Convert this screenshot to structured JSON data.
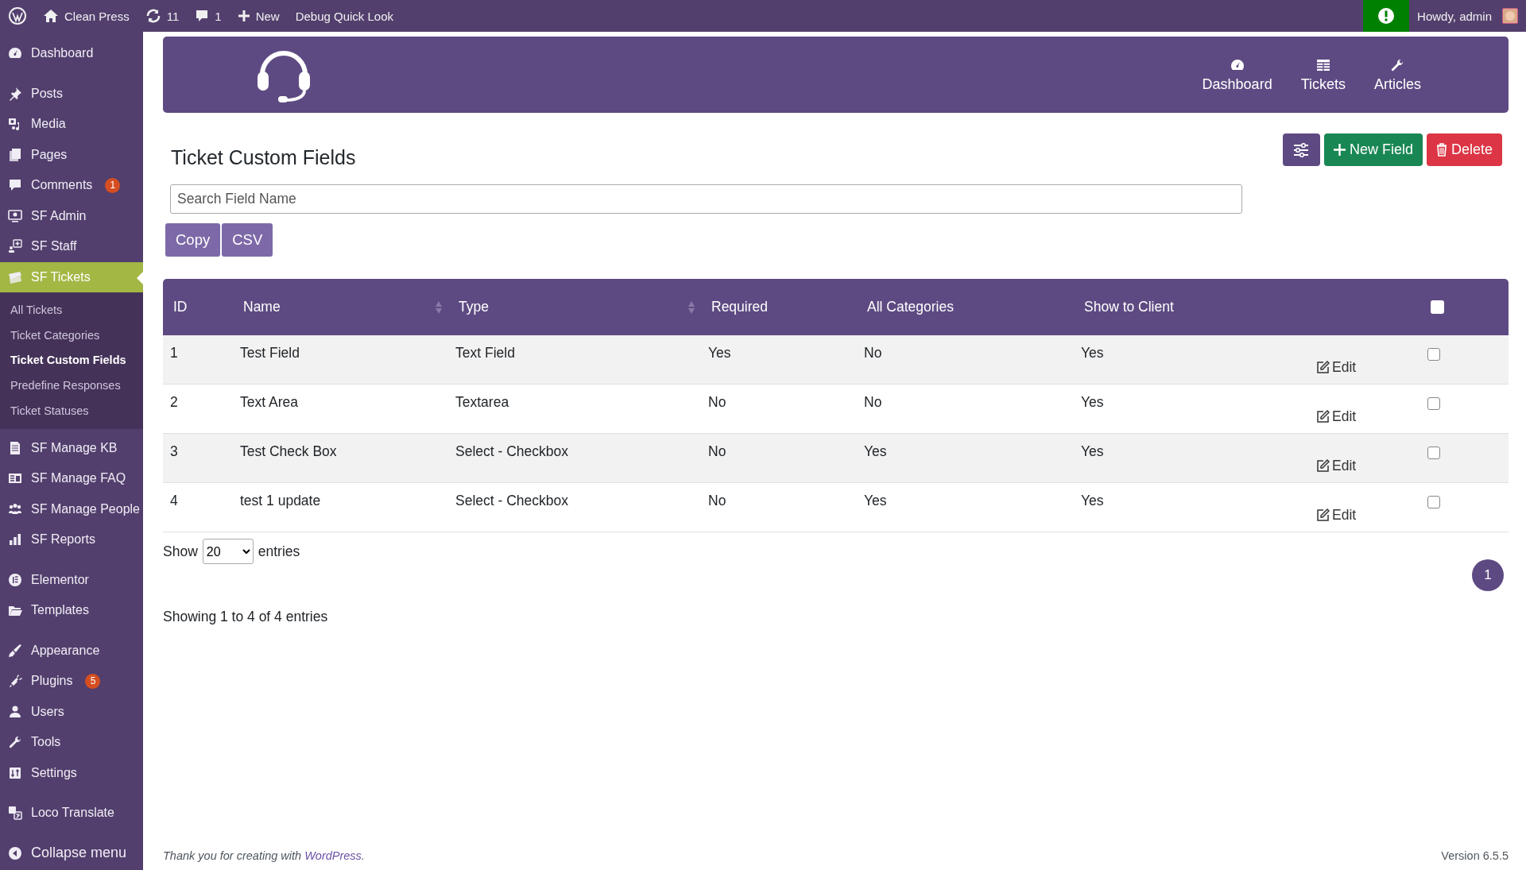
{
  "admin_bar": {
    "site_name": "Clean Press",
    "updates": "11",
    "comments": "1",
    "new_label": "New",
    "debug_label": "Debug Quick Look",
    "greeting": "Howdy, admin"
  },
  "sidebar": {
    "groups": [
      [
        {
          "label": "Dashboard",
          "kind": "dashboard",
          "selected": false
        }
      ],
      [
        {
          "label": "Posts",
          "kind": "pin",
          "selected": false
        },
        {
          "label": "Media",
          "kind": "media",
          "selected": false
        },
        {
          "label": "Pages",
          "kind": "pages",
          "selected": false
        },
        {
          "label": "Comments",
          "kind": "comment",
          "badge": "1",
          "selected": false
        },
        {
          "label": "SF Admin",
          "kind": "monitor",
          "selected": false
        },
        {
          "label": "SF Staff",
          "kind": "staff",
          "selected": false
        },
        {
          "label": "SF Tickets",
          "kind": "tickets",
          "selected": true,
          "children": [
            {
              "label": "All Tickets",
              "selected": false
            },
            {
              "label": "Ticket Categories",
              "selected": false
            },
            {
              "label": "Ticket Custom Fields",
              "selected": true
            },
            {
              "label": "Predefine Responses",
              "selected": false
            },
            {
              "label": "Ticket Statuses",
              "selected": false
            }
          ]
        },
        {
          "label": "SF Manage KB",
          "kind": "document",
          "selected": false
        },
        {
          "label": "SF Manage FAQ",
          "kind": "faq",
          "selected": false
        },
        {
          "label": "SF Manage People",
          "kind": "people",
          "selected": false
        },
        {
          "label": "SF Reports",
          "kind": "chart",
          "selected": false
        }
      ],
      [
        {
          "label": "Elementor",
          "kind": "elementor",
          "selected": false
        },
        {
          "label": "Templates",
          "kind": "folder",
          "selected": false
        }
      ],
      [
        {
          "label": "Appearance",
          "kind": "brush",
          "selected": false
        },
        {
          "label": "Plugins",
          "kind": "plug",
          "badge": "5",
          "selected": false
        },
        {
          "label": "Users",
          "kind": "user",
          "selected": false
        },
        {
          "label": "Tools",
          "kind": "wrench",
          "selected": false
        },
        {
          "label": "Settings",
          "kind": "settings",
          "selected": false
        }
      ],
      [
        {
          "label": "Loco Translate",
          "kind": "translate",
          "selected": false
        }
      ],
      [
        {
          "label": "Collapse menu",
          "kind": "collapse",
          "selected": false
        }
      ]
    ]
  },
  "header_nav": [
    {
      "label": "Dashboard",
      "kind": "dashboard"
    },
    {
      "label": "Tickets",
      "kind": "table"
    },
    {
      "label": "Articles",
      "kind": "wrench"
    }
  ],
  "page_title": "Ticket Custom Fields",
  "actions": {
    "new_label": "New Field",
    "delete_label": "Delete"
  },
  "search": {
    "placeholder": "Search Field Name"
  },
  "export_buttons": [
    "Copy",
    "CSV"
  ],
  "table": {
    "columns": [
      {
        "label": "ID",
        "sortable": false
      },
      {
        "label": "Name",
        "sortable": true
      },
      {
        "label": "Type",
        "sortable": true
      },
      {
        "label": "Required",
        "sortable": false
      },
      {
        "label": "All Categories",
        "sortable": false
      },
      {
        "label": "Show to Client",
        "sortable": false
      }
    ],
    "select_all_checked": false,
    "rows": [
      {
        "cells": [
          "1",
          "Test Field",
          "Text Field",
          "Yes",
          "No",
          "Yes"
        ],
        "edit_label": "Edit",
        "checked": false
      },
      {
        "cells": [
          "2",
          "Text Area",
          "Textarea",
          "No",
          "No",
          "Yes"
        ],
        "edit_label": "Edit",
        "checked": false
      },
      {
        "cells": [
          "3",
          "Test Check Box",
          "Select - Checkbox",
          "No",
          "Yes",
          "Yes"
        ],
        "edit_label": "Edit",
        "checked": false
      },
      {
        "cells": [
          "4",
          "test 1 update",
          "Select - Checkbox",
          "No",
          "Yes",
          "Yes"
        ],
        "edit_label": "Edit",
        "checked": false
      }
    ]
  },
  "length_menu": {
    "show_label": "Show",
    "value": "20",
    "entries_label": "entries"
  },
  "pagination": [
    {
      "label": "1",
      "selected": true
    }
  ],
  "info": "Showing 1 to 4 of 4 entries",
  "footer": {
    "thanks": "Thank you for creating with ",
    "link": "WordPress",
    "after": ".",
    "version": "Version 6.5.5"
  }
}
